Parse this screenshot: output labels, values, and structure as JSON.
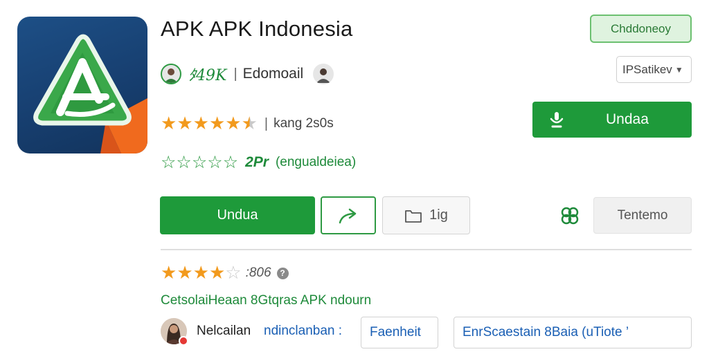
{
  "app": {
    "title": "APK APK Indonesia",
    "icon": "app-logo-a-icon"
  },
  "developer": {
    "name": "ﾀ49K",
    "separator": "|",
    "email": "Edomoail"
  },
  "rating": {
    "stars": 4.5,
    "separator": "|",
    "meta": "kang 2s0s"
  },
  "outline_rating": {
    "stars": 5,
    "count": "2Pr",
    "note": "(engualdeiea)"
  },
  "top_right": {
    "pill_label": "Chddoneoy",
    "select_value": "IPSatikev",
    "install_label": "Undaa"
  },
  "actions": {
    "main_label": "Undua",
    "save_label": "1ig",
    "gray_label": "Tentemo"
  },
  "review": {
    "stars": 4,
    "count": ":806",
    "info": "?"
  },
  "category_text": "CetsolaiHeaan  8Gtqras APK ndourn",
  "bottom": {
    "name": "Nelcailan",
    "sub": "ndinclanban :",
    "tag_one": "Faenheit",
    "tag_two": "EnrScaestain 8Baia (uTiote ’"
  },
  "colors": {
    "brand_green": "#1e9a3a",
    "star_orange": "#f29a1d",
    "link_blue": "#1a5fb4",
    "icon_bg": "#173f70"
  }
}
